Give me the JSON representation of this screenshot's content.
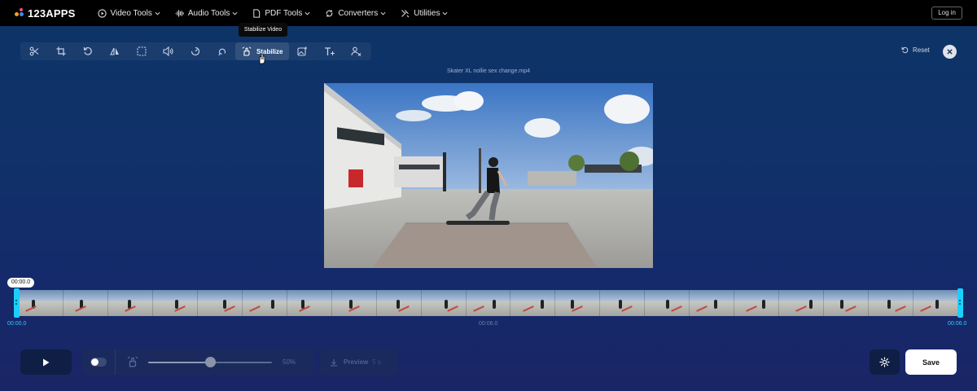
{
  "brand": {
    "name": "123APPS"
  },
  "nav": {
    "items": [
      {
        "label": "Video Tools",
        "icon": "play-circle-icon"
      },
      {
        "label": "Audio Tools",
        "icon": "waveform-icon"
      },
      {
        "label": "PDF Tools",
        "icon": "document-icon"
      },
      {
        "label": "Converters",
        "icon": "convert-icon"
      },
      {
        "label": "Utilities",
        "icon": "tools-icon"
      }
    ],
    "login_label": "Log in"
  },
  "tooltip": {
    "text": "Stabilize Video"
  },
  "toolbar": {
    "tools": [
      {
        "name": "trim",
        "icon": "scissors-icon"
      },
      {
        "name": "crop",
        "icon": "crop-icon"
      },
      {
        "name": "rotate",
        "icon": "rotate-icon"
      },
      {
        "name": "flip",
        "icon": "flip-icon"
      },
      {
        "name": "resize",
        "icon": "resize-icon"
      },
      {
        "name": "volume",
        "icon": "volume-icon"
      },
      {
        "name": "speed",
        "icon": "speed-icon"
      },
      {
        "name": "loop",
        "icon": "loop-icon"
      },
      {
        "name": "stabilize",
        "icon": "stabilize-icon",
        "label": "Stabilize",
        "active": true
      },
      {
        "name": "add-image",
        "icon": "add-image-icon"
      },
      {
        "name": "add-text",
        "icon": "add-text-icon"
      },
      {
        "name": "remove-logo",
        "icon": "remove-logo-icon"
      }
    ],
    "active_label": "Stabilize",
    "reset_label": "Reset"
  },
  "file": {
    "name": "Skater XL nollie sex change.mp4"
  },
  "timeline": {
    "current_time": "00:00.0",
    "start_label": "00:00.0",
    "mid_label": "00:06.0",
    "end_label": "00:06.0",
    "frame_count": 21
  },
  "controls": {
    "stabilize_strength_percent": 50,
    "strength_label": "50%",
    "preview_label": "Preview",
    "preview_seconds": "5 s",
    "save_label": "Save",
    "toggle_on": false
  },
  "colors": {
    "accent": "#1ad0ff",
    "nav_bg": "#000000",
    "page_bg_top": "#0d3466",
    "page_bg_bottom": "#1a2566"
  }
}
